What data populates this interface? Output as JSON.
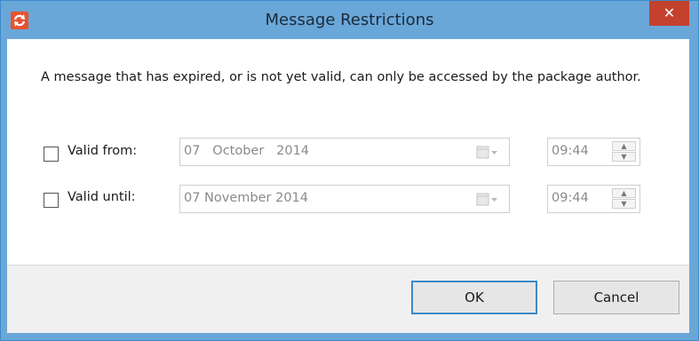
{
  "window": {
    "title": "Message Restrictions",
    "close_label": "✕"
  },
  "description": "A message that has expired, or is not yet valid, can only be accessed by the package author.",
  "rows": [
    {
      "label": "Valid from:",
      "date": "07   October   2014",
      "time": "09:44",
      "checked": false
    },
    {
      "label": "Valid until:",
      "date": "07 November 2014",
      "time": "09:44",
      "checked": false
    }
  ],
  "buttons": {
    "ok": "OK",
    "cancel": "Cancel"
  },
  "icons": {
    "app": "refresh-icon",
    "calendar": "calendar-dropdown-icon",
    "spin_up": "spin-up-icon",
    "spin_down": "spin-down-icon"
  },
  "colors": {
    "titlebar": "#6aa7d9",
    "close": "#c4412d",
    "app_icon": "#e8532f",
    "default_border": "#3c89c9"
  }
}
